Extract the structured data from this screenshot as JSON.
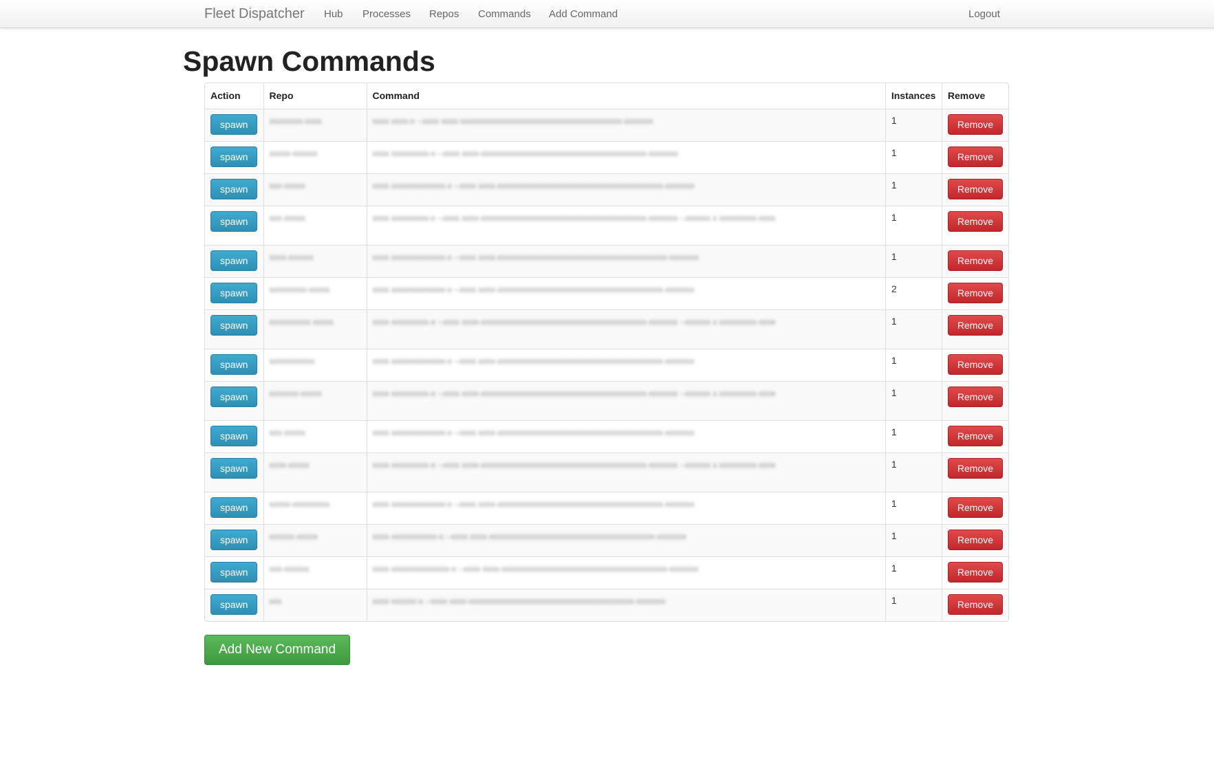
{
  "navbar": {
    "brand": "Fleet Dispatcher",
    "links": [
      "Hub",
      "Processes",
      "Repos",
      "Commands",
      "Add Command"
    ],
    "logout": "Logout"
  },
  "page": {
    "title": "Spawn Commands"
  },
  "table": {
    "headers": {
      "action": "Action",
      "repo": "Repo",
      "command": "Command",
      "instances": "Instances",
      "remove": "Remove"
    },
    "spawn_label": "spawn",
    "remove_label": "Remove",
    "rows": [
      {
        "repo": "xxxxxxxx-xxxx",
        "command": "xxxx xxxx-x --xxxx xxxx-xxxxxxxxxxxxxxxxxxxxxxxxxxxxxxxxxxxxxxx-xxxxxxx",
        "instances": "1"
      },
      {
        "repo": "xxxxx-xxxxxx",
        "command": "xxxx xxxxxxxxx-x --xxxx xxxx-xxxxxxxxxxxxxxxxxxxxxxxxxxxxxxxxxxxxxxxx-xxxxxxx",
        "instances": "1"
      },
      {
        "repo": "xxx-xxxxx",
        "command": "xxxx xxxxxxxxxxxxx-x --xxxx xxxx-xxxxxxxxxxxxxxxxxxxxxxxxxxxxxxxxxxxxxxxx-xxxxxxx",
        "instances": "1"
      },
      {
        "repo": "xxx-xxxxx",
        "command": "xxxx xxxxxxxxx-x --xxxx xxxx-xxxxxxxxxxxxxxxxxxxxxxxxxxxxxxxxxxxxxxxx-xxxxxxx --xxxxxx x xxxxxxxxx-xxxx",
        "instances": "1"
      },
      {
        "repo": "xxxx-xxxxxx",
        "command": "xxxx xxxxxxxxxxxxx-x --xxxx xxxx-xxxxxxxxxxxxxxxxxxxxxxxxxxxxxxxxxxxxxxxxx-xxxxxxx",
        "instances": "1"
      },
      {
        "repo": "xxxxxxxxx-xxxxx",
        "command": "xxxx xxxxxxxxxxxxx-x --xxxx xxxx-xxxxxxxxxxxxxxxxxxxxxxxxxxxxxxxxxxxxxxxx-xxxxxxx",
        "instances": "2"
      },
      {
        "repo": "xxxxxxxxxx xxxxx",
        "command": "xxxx xxxxxxxxx-x --xxxx xxxx-xxxxxxxxxxxxxxxxxxxxxxxxxxxxxxxxxxxxxxxx-xxxxxxx --xxxxxx x xxxxxxxxx-xxxx",
        "instances": "1"
      },
      {
        "repo": "xxxxxxxxxxx",
        "command": "xxxx xxxxxxxxxxxxx-x --xxxx xxxx-xxxxxxxxxxxxxxxxxxxxxxxxxxxxxxxxxxxxxxxx-xxxxxxx",
        "instances": "1"
      },
      {
        "repo": "xxxxxxx-xxxxx",
        "command": "xxxx xxxxxxxxx-x --xxxx xxxx-xxxxxxxxxxxxxxxxxxxxxxxxxxxxxxxxxxxxxxxx-xxxxxxx --xxxxxx x xxxxxxxxx-xxxx",
        "instances": "1"
      },
      {
        "repo": "xxx-xxxxx",
        "command": "xxxx xxxxxxxxxxxxx-x --xxxx xxxx-xxxxxxxxxxxxxxxxxxxxxxxxxxxxxxxxxxxxxxxx-xxxxxxx",
        "instances": "1"
      },
      {
        "repo": "xxxx-xxxxx",
        "command": "xxxx xxxxxxxxx-x --xxxx xxxx-xxxxxxxxxxxxxxxxxxxxxxxxxxxxxxxxxxxxxxxx-xxxxxxx --xxxxxx x xxxxxxxxx-xxxx",
        "instances": "1"
      },
      {
        "repo": "xxxxx-xxxxxxxxx",
        "command": "xxxx xxxxxxxxxxxxx-x --xxxx xxxx-xxxxxxxxxxxxxxxxxxxxxxxxxxxxxxxxxxxxxxxx-xxxxxxx",
        "instances": "1"
      },
      {
        "repo": "xxxxxx-xxxxx",
        "command": "xxxx xxxxxxxxxxx-x --xxxx xxxx-xxxxxxxxxxxxxxxxxxxxxxxxxxxxxxxxxxxxxxxx-xxxxxxx",
        "instances": "1"
      },
      {
        "repo": "xxx-xxxxxx",
        "command": "xxxx xxxxxxxxxxxxxx-x --xxxx xxxx-xxxxxxxxxxxxxxxxxxxxxxxxxxxxxxxxxxxxxxxx-xxxxxxx",
        "instances": "1"
      },
      {
        "repo": "xxx",
        "command": "xxxx xxxxxx-x --xxxx xxxx-xxxxxxxxxxxxxxxxxxxxxxxxxxxxxxxxxxxxxxxx-xxxxxxx",
        "instances": "1"
      }
    ]
  },
  "actions": {
    "add_new": "Add New Command"
  }
}
